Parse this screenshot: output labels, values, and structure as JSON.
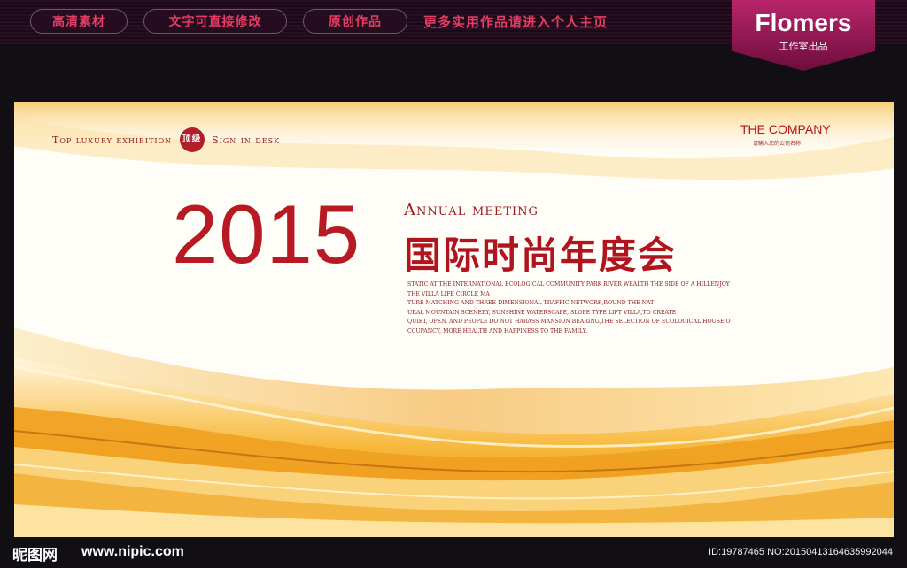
{
  "nav": {
    "items": [
      {
        "label": "高清素材"
      },
      {
        "label": "文字可直接修改"
      },
      {
        "label": "原创作品"
      }
    ],
    "promo": "更多实用作品请进入个人主页"
  },
  "brand": {
    "title": "Flomers",
    "subtitle": "工作室出品"
  },
  "poster": {
    "tagline_left": "Top luxury exhibition",
    "badge": "顶级",
    "tagline_right": "Sign in desk",
    "company": "THE COMPANY",
    "company_sub": "请输入您的公司名称",
    "year": "2015",
    "annual": "Annual meeting",
    "cn_title": "国际时尚年度会",
    "body_lines": [
      "STATIC AT THE INTERNATIONAL ECOLOGICAL COMMUNITY PARK RIVER WEALTH THE SIDE OF A HILLENJOY",
      "THE VILLA LIFE CIRCLE MA",
      "TURE MATCHING AND THREE-DIMENSIONAL TRAFFIC NETWORK,ROUND THE NAT",
      "URAL MOUNTAIN SCENERY, SUNSHINE WATERSCAPE, SLOPE TYPE LIFT VILLA,TO CREATE",
      "QUIET, OPEN, AND PEOPLE DO NOT HARASS MANSION BEARING,THE SELECTION OF ECOLOGICAL HOUSE O",
      "CCUPANCY, MORE HEALTH AND HAPPINESS TO THE FAMILY."
    ],
    "colors": {
      "accent_red": "#b81a24",
      "gold": "#e8a21c"
    }
  },
  "footer": {
    "logo_text": "昵图网",
    "url": "www.nipic.com",
    "image_id": "ID:19787465 NO:20150413164635992044"
  }
}
